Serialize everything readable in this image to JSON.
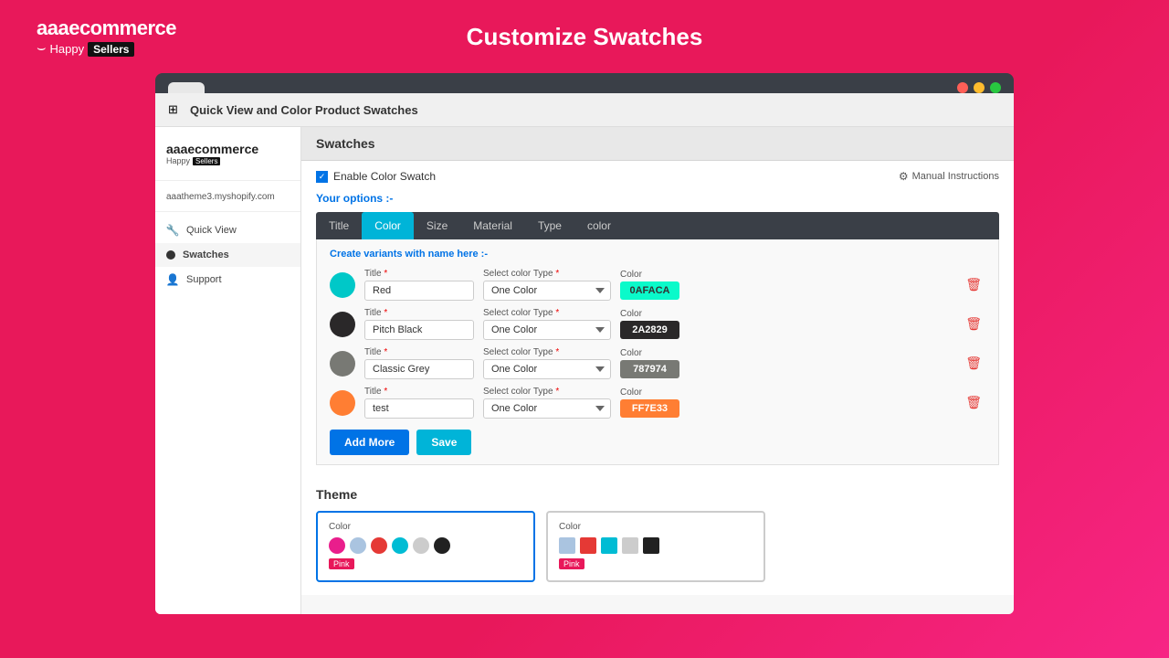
{
  "header": {
    "brand": "aaaecommerce",
    "tagline": "Happy",
    "sellers_badge": "Sellers",
    "page_title": "Customize Swatches"
  },
  "browser": {
    "tab_label": ""
  },
  "app": {
    "icon": "⊞",
    "title": "Quick View and Color Product Swatches"
  },
  "sidebar": {
    "brand_name": "aaaecommerce",
    "brand_tagline": "Happy",
    "brand_sellers": "Sellers",
    "store_url": "aaatheme3.myshopify.com",
    "nav_items": [
      {
        "id": "quick-view",
        "label": "Quick View",
        "icon": "🔧"
      },
      {
        "id": "swatches",
        "label": "Swatches",
        "active": true
      },
      {
        "id": "support",
        "label": "Support",
        "icon": "👤"
      }
    ]
  },
  "swatches": {
    "section_title": "Swatches",
    "enable_label": "Enable Color Swatch",
    "manual_instructions": "Manual Instructions",
    "your_options": "Your options :-",
    "tabs": [
      {
        "id": "title",
        "label": "Title"
      },
      {
        "id": "color",
        "label": "Color",
        "active": true
      },
      {
        "id": "size",
        "label": "Size"
      },
      {
        "id": "material",
        "label": "Material"
      },
      {
        "id": "type",
        "label": "Type"
      },
      {
        "id": "color2",
        "label": "color"
      }
    ],
    "create_variants_label": "Create variants with name here :-",
    "variants": [
      {
        "title": "Red",
        "color_type": "One Color",
        "color_hex": "0AFACA",
        "color_bg": "#0AFACA",
        "circle_color": "#00C8C8"
      },
      {
        "title": "Pitch Black",
        "color_type": "One Color",
        "color_hex": "2A2829",
        "color_bg": "#2A2829",
        "circle_color": "#2A2829"
      },
      {
        "title": "Classic Grey",
        "color_type": "One Color",
        "color_hex": "787974",
        "color_bg": "#787974",
        "circle_color": "#787974"
      },
      {
        "title": "test",
        "color_type": "One Color",
        "color_hex": "FF7E33",
        "color_bg": "#FF7E33",
        "circle_color": "#FF7E33"
      }
    ],
    "title_field_label": "Title *",
    "select_color_type_label": "Select color Type *",
    "color_label": "Color",
    "add_more_label": "Add More",
    "save_label": "Save"
  },
  "theme": {
    "label": "Theme",
    "card1": {
      "label": "Color",
      "swatches": [
        {
          "color": "#e91e8c",
          "shape": "circle"
        },
        {
          "color": "#aac4e0",
          "shape": "circle"
        },
        {
          "color": "#e53935",
          "shape": "circle"
        },
        {
          "color": "#00bcd4",
          "shape": "circle"
        },
        {
          "color": "#ccc",
          "shape": "circle"
        },
        {
          "color": "#212121",
          "shape": "circle"
        }
      ],
      "pink_label": "Pink",
      "selected": true
    },
    "card2": {
      "label": "Color",
      "swatches": [
        {
          "color": "#aac4e0",
          "shape": "square"
        },
        {
          "color": "#e53935",
          "shape": "square"
        },
        {
          "color": "#00bcd4",
          "shape": "square"
        },
        {
          "color": "#ccc",
          "shape": "square"
        },
        {
          "color": "#212121",
          "shape": "square"
        }
      ],
      "pink_label": "Pink",
      "selected": false
    }
  }
}
